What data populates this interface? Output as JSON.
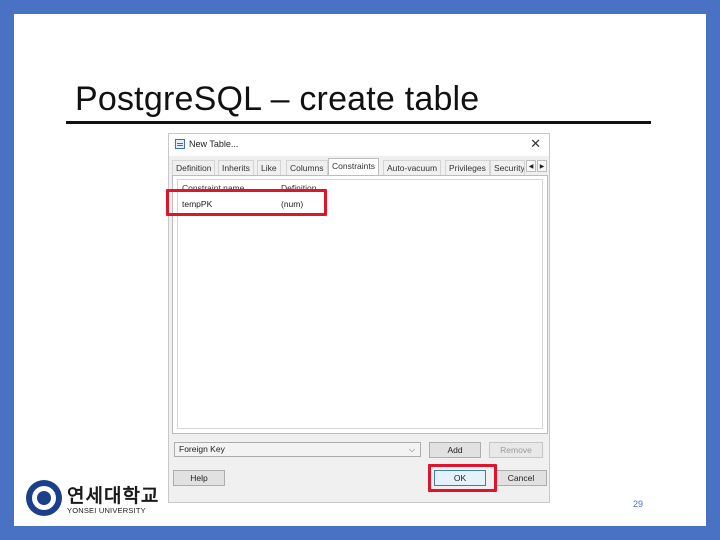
{
  "slide": {
    "title": "PostgreSQL – create table",
    "page_number": "29",
    "logo": {
      "korean": "연세대학교",
      "english": "YONSEI UNIVERSITY"
    },
    "border_color": "#4a72c4",
    "highlight_color": "#e0142b"
  },
  "dialog": {
    "title": "New Table...",
    "close_icon": "close-icon",
    "tabs": [
      "Definition",
      "Inherits",
      "Like",
      "Columns",
      "Constraints",
      "Auto-vacuum",
      "Privileges",
      "Security"
    ],
    "active_tab": "Constraints",
    "tab_scroll": {
      "left": "◀",
      "right": "▶"
    },
    "list": {
      "headers": [
        "Constraint name",
        "Definition"
      ],
      "rows": [
        {
          "name": "tempPK",
          "definition": "(num)"
        }
      ]
    },
    "constraint_type": {
      "selected": "Foreign Key"
    },
    "buttons": {
      "add": "Add",
      "remove": "Remove",
      "help": "Help",
      "ok": "OK",
      "cancel": "Cancel"
    }
  }
}
